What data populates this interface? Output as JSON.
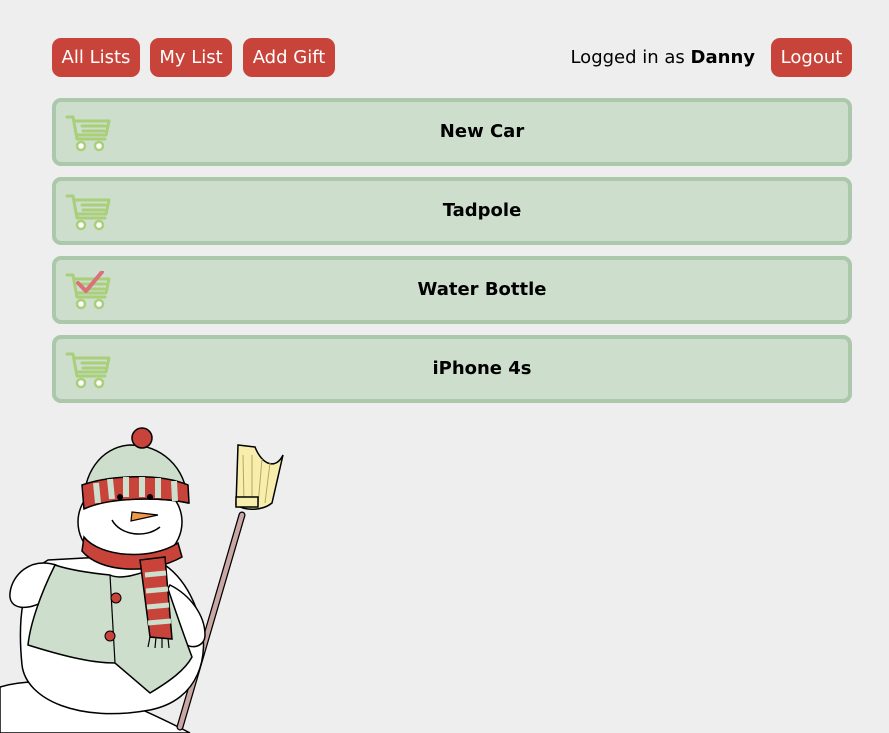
{
  "nav": {
    "all_lists": "All Lists",
    "my_list": "My List",
    "add_gift": "Add Gift",
    "logout": "Logout"
  },
  "session": {
    "logged_in_prefix": "Logged in as",
    "username": "Danny"
  },
  "gifts": [
    {
      "name": "New Car",
      "icon": "shopping-cart-icon"
    },
    {
      "name": "Tadpole",
      "icon": "shopping-cart-icon"
    },
    {
      "name": "Water Bottle",
      "icon": "shopping-cart-checked-icon"
    },
    {
      "name": "iPhone 4s",
      "icon": "shopping-cart-icon"
    }
  ],
  "colors": {
    "background": "#eeeeee",
    "button": "#c8443a",
    "item_fill": "#cddecd",
    "item_border": "#abc8ab",
    "cart_icon": "#a9cf79",
    "check_mark": "#d9707a"
  }
}
